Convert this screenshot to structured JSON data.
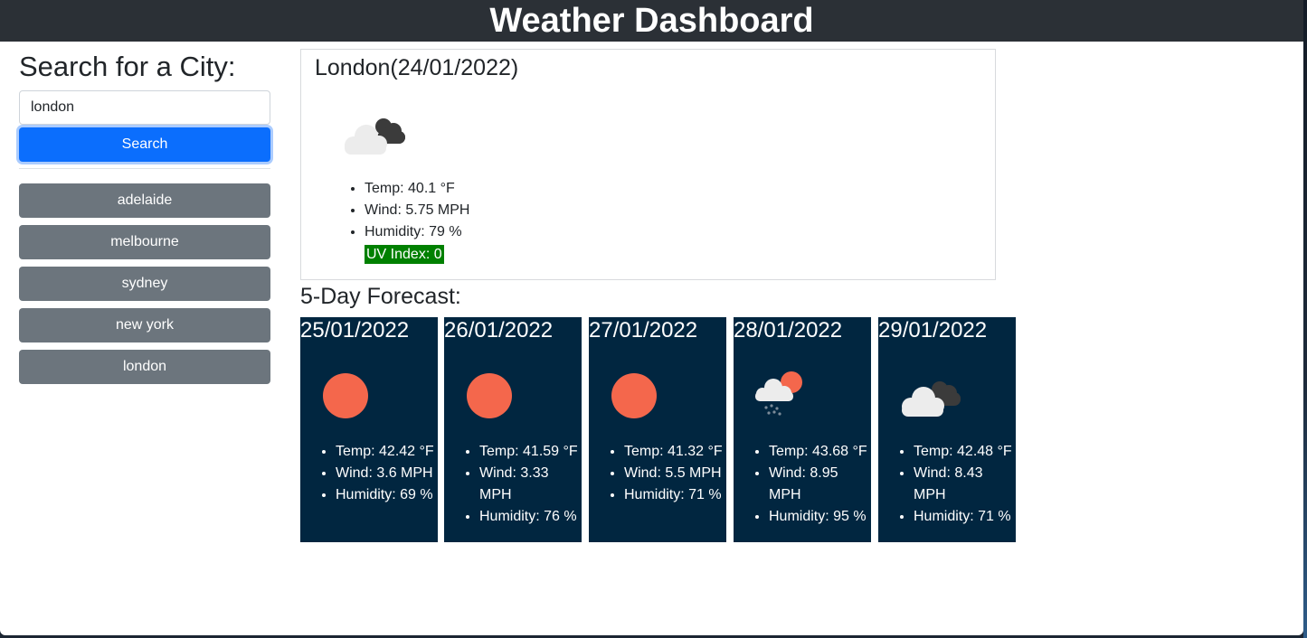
{
  "header": {
    "title": "Weather Dashboard"
  },
  "search": {
    "heading": "Search for a City:",
    "value": "london",
    "button_label": "Search",
    "history": [
      "adelaide",
      "melbourne",
      "sydney",
      "new york",
      "london"
    ]
  },
  "current": {
    "title": "London(24/01/2022)",
    "icon": "broken-clouds-icon",
    "temp": "Temp: 40.1 °F",
    "wind": "Wind: 5.75 MPH",
    "humidity": "Humidity: 79 %",
    "uv": "UV Index: 0",
    "uv_color": "#008000"
  },
  "forecast": {
    "title": "5-Day Forecast:",
    "card_color": "#012640",
    "days": [
      {
        "date": "25/01/2022",
        "icon": "clear-sky-icon",
        "temp": "Temp: 42.42 °F",
        "wind": "Wind: 3.6 MPH",
        "humidity": "Humidity: 69 %"
      },
      {
        "date": "26/01/2022",
        "icon": "clear-sky-icon",
        "temp": "Temp: 41.59 °F",
        "wind": "Wind: 3.33 MPH",
        "humidity": "Humidity: 76 %"
      },
      {
        "date": "27/01/2022",
        "icon": "clear-sky-icon",
        "temp": "Temp: 41.32 °F",
        "wind": "Wind: 5.5 MPH",
        "humidity": "Humidity: 71 %"
      },
      {
        "date": "28/01/2022",
        "icon": "rain-icon",
        "temp": "Temp: 43.68 °F",
        "wind": "Wind: 8.95 MPH",
        "humidity": "Humidity: 95 %"
      },
      {
        "date": "29/01/2022",
        "icon": "broken-clouds-icon",
        "temp": "Temp: 42.48 °F",
        "wind": "Wind: 8.43 MPH",
        "humidity": "Humidity: 71 %"
      }
    ]
  },
  "colors": {
    "accent": "#0b6efd",
    "history_button": "#6c757d",
    "header_bg": "#2b3036",
    "sun": "#f4674c"
  }
}
